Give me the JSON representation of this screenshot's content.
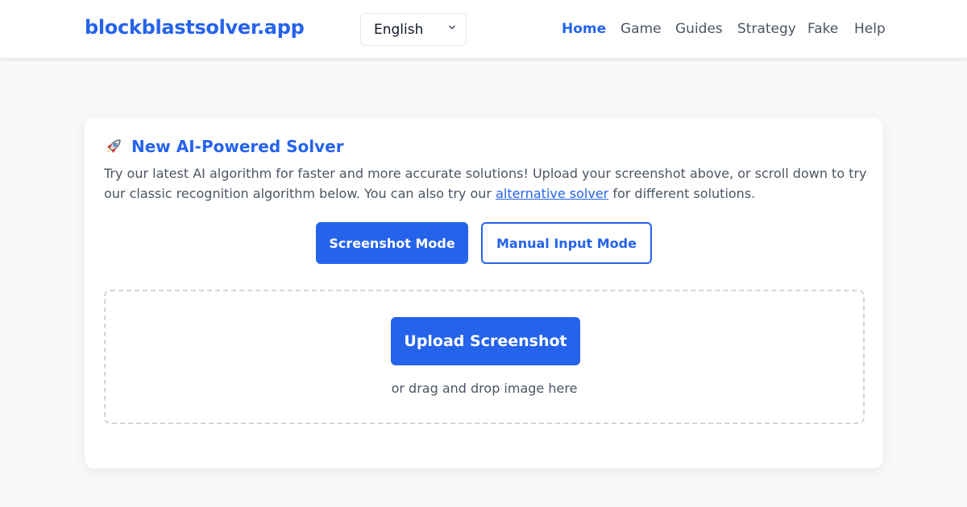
{
  "header": {
    "logo": "blockblastsolver.app",
    "language": {
      "selected": "English"
    },
    "nav": [
      {
        "label": "Home",
        "active": true
      },
      {
        "label": "Game",
        "active": false
      },
      {
        "label": "Guides",
        "active": false
      },
      {
        "label": "Strategy",
        "active": false
      },
      {
        "label": "Fake",
        "active": false
      },
      {
        "label": "Help",
        "active": false
      }
    ]
  },
  "card": {
    "icon": "rocket-icon",
    "icon_glyph": "🚀",
    "title": "New AI-Powered Solver",
    "desc_before": "Try our latest AI algorithm for faster and more accurate solutions! Upload your screenshot above, or scroll down to try our classic recognition algorithm below. You can also try our ",
    "desc_link": "alternative solver",
    "desc_after": " for different solutions.",
    "modes": {
      "screenshot": "Screenshot Mode",
      "manual": "Manual Input Mode"
    },
    "upload": {
      "button": "Upload Screenshot",
      "hint": "or drag and drop image here"
    }
  },
  "colors": {
    "accent": "#2563eb",
    "background": "#f7f9fb",
    "text": "#4b5563"
  }
}
